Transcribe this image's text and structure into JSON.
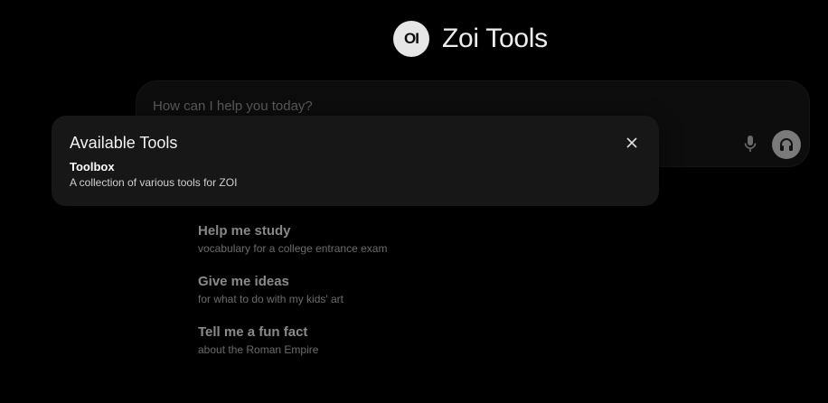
{
  "brand": {
    "logo_text": "OI",
    "title": "Zoi Tools"
  },
  "chat_input": {
    "placeholder": "How can I help you today?"
  },
  "icons": {
    "mic": "microphone-icon",
    "voice": "headphones-icon",
    "close": "close-icon"
  },
  "suggestions": [
    {
      "title": "Help me study",
      "subtitle": "vocabulary for a college entrance exam"
    },
    {
      "title": "Give me ideas",
      "subtitle": "for what to do with my kids' art"
    },
    {
      "title": "Tell me a fun fact",
      "subtitle": "about the Roman Empire"
    }
  ],
  "tools_panel": {
    "heading": "Available Tools",
    "tools": [
      {
        "name": "Toolbox",
        "description": "A collection of various tools for ZOI"
      }
    ]
  }
}
